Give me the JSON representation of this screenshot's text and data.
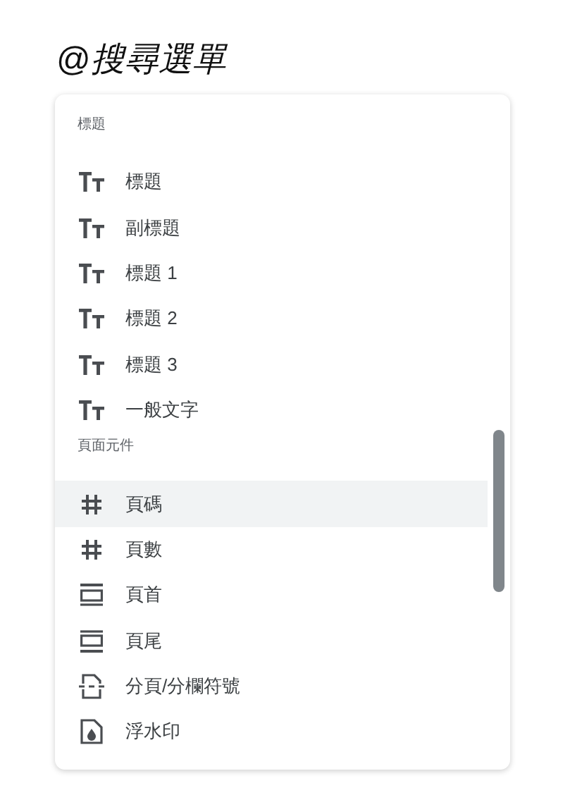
{
  "search": {
    "value": "@*搜尋選單*"
  },
  "sections": [
    {
      "heading": "標題",
      "items": [
        {
          "label": "標題",
          "kind": "text",
          "selected": false
        },
        {
          "label": "副標題",
          "kind": "text",
          "selected": false
        },
        {
          "label": "標題 1",
          "kind": "text",
          "selected": false
        },
        {
          "label": "標題 2",
          "kind": "text",
          "selected": false
        },
        {
          "label": "標題 3",
          "kind": "text",
          "selected": false
        },
        {
          "label": "一般文字",
          "kind": "text",
          "selected": false
        }
      ]
    },
    {
      "heading": "頁面元件",
      "items": [
        {
          "label": "頁碼",
          "kind": "hash",
          "selected": true
        },
        {
          "label": "頁數",
          "kind": "hash",
          "selected": false
        },
        {
          "label": "頁首",
          "kind": "header",
          "selected": false
        },
        {
          "label": "頁尾",
          "kind": "footer",
          "selected": false
        },
        {
          "label": "分頁/分欄符號",
          "kind": "pagebreak",
          "selected": false
        },
        {
          "label": "浮水印",
          "kind": "watermark",
          "selected": false
        }
      ]
    }
  ]
}
